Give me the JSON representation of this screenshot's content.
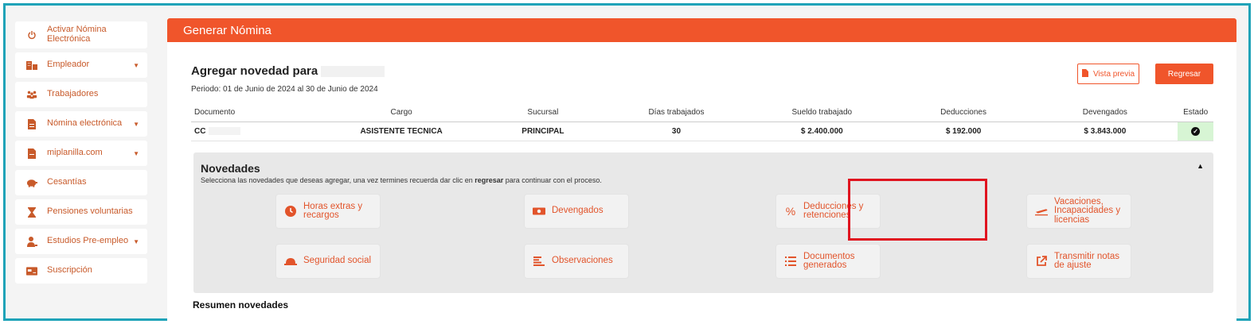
{
  "sidebar": {
    "items": [
      {
        "label": "Activar Nómina Electrónica",
        "icon": "power-icon",
        "caret": false
      },
      {
        "label": "Empleador",
        "icon": "building-icon",
        "caret": true
      },
      {
        "label": "Trabajadores",
        "icon": "people-icon",
        "caret": false
      },
      {
        "label": "Nómina electrónica",
        "icon": "document-icon",
        "caret": true
      },
      {
        "label": "miplanilla.com",
        "icon": "file-icon",
        "caret": true
      },
      {
        "label": "Cesantías",
        "icon": "piggy-bank-icon",
        "caret": false
      },
      {
        "label": "Pensiones voluntarias",
        "icon": "hourglass-icon",
        "caret": false
      },
      {
        "label": "Estudios Pre-empleo",
        "icon": "person-icon",
        "caret": true
      },
      {
        "label": "Suscripción",
        "icon": "card-icon",
        "caret": false
      }
    ]
  },
  "main": {
    "header_title": "Generar Nómina",
    "title": "Agregar novedad para",
    "periodo": "Periodo: 01 de Junio de 2024 al 30 de Junio de 2024",
    "preview_label": "Vista previa",
    "back_label": "Regresar"
  },
  "table": {
    "headers": [
      "Documento",
      "Cargo",
      "Sucursal",
      "Días trabajados",
      "Sueldo trabajado",
      "Deducciones",
      "Devengados",
      "Estado"
    ],
    "row": {
      "documento": "CC",
      "cargo": "ASISTENTE TECNICA",
      "sucursal": "PRINCIPAL",
      "dias": "30",
      "sueldo": "$ 2.400.000",
      "deducciones": "$ 192.000",
      "devengados": "$ 3.843.000"
    }
  },
  "novedades": {
    "title": "Novedades",
    "desc_before": "Selecciona las novedades que deseas agregar, una vez termines recuerda dar clic en ",
    "desc_bold": "regresar",
    "desc_after": " para continuar con el proceso.",
    "cards": {
      "horas": "Horas extras y recargos",
      "devengados": "Devengados",
      "deducciones": "Deducciones y retenciones",
      "vacaciones": "Vacaciones, Incapacidades y licencias",
      "seguridad": "Seguridad social",
      "observaciones": "Observaciones",
      "documentos": "Documentos generados",
      "transmitir": "Transmitir notas de ajuste"
    }
  },
  "resumen_title": "Resumen novedades",
  "colors": {
    "accent": "#f0552b",
    "frame": "#1fa3b8",
    "highlight": "#e0131f",
    "estado_ok": "#d7f5d4"
  }
}
